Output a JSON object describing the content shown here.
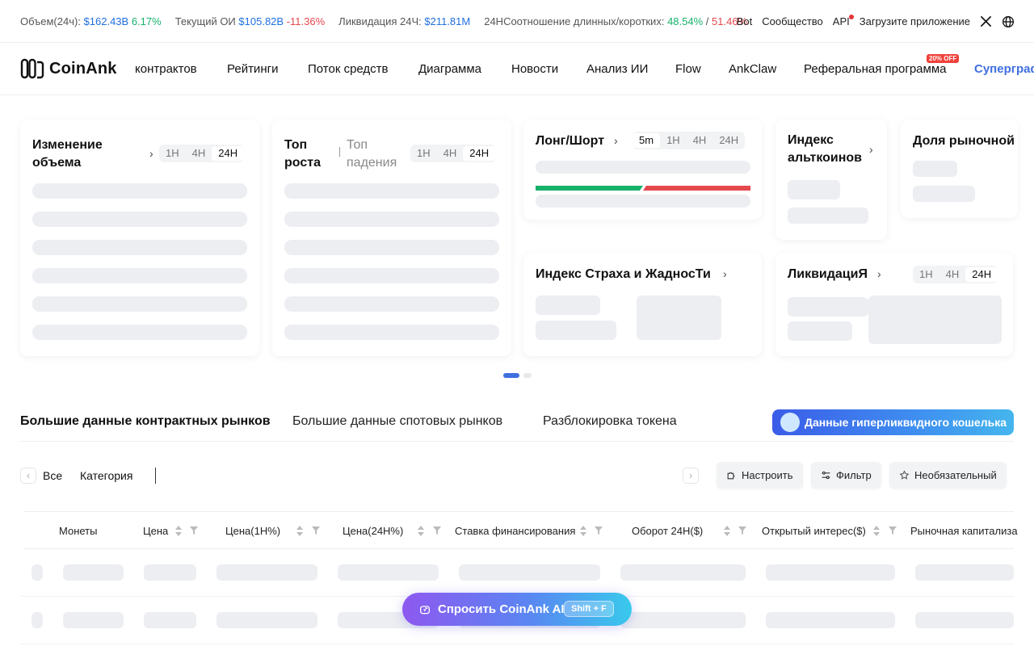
{
  "ticker": {
    "volume_label": "Объем(24ч):",
    "volume_value": "$162.43B",
    "volume_change": "6.17%",
    "oi_label": "Текущий ОИ",
    "oi_value": "$105.82B",
    "oi_change": "-11.36%",
    "liq_label": "Ликвидация 24Ч:",
    "liq_value": "$211.81M",
    "ratio_label": "24НСоотношение длинных/коротких:",
    "ratio_long": "48.54%",
    "ratio_sep": "/",
    "ratio_short": "51.46%",
    "links": [
      "Bot",
      "Сообщество",
      "API",
      "Загрузите приложение"
    ]
  },
  "nav": {
    "logo": "CoinAnk",
    "items": [
      "контрактов",
      "Рейтинги",
      "Поток средств",
      "Диаграмма",
      "Новости",
      "Анализ ИИ",
      "Flow",
      "AnkClaw",
      "Реферальная программа",
      "Суперграф"
    ],
    "badge": "20% OFF"
  },
  "cards": {
    "volume_change": {
      "title": "Изменение объема",
      "periods": [
        "1H",
        "4H",
        "24H"
      ],
      "active": "24H"
    },
    "top": {
      "tab_rise": "Топ роста",
      "tab_fall": "Топ падения",
      "periods": [
        "1H",
        "4H",
        "24H"
      ],
      "active": "24H"
    },
    "long_short": {
      "title": "Лонг/Шорт",
      "periods": [
        "5m",
        "1H",
        "4H",
        "24H"
      ],
      "active": "5m",
      "long_ratio": 0.5
    },
    "altcoin": {
      "title": "Индекс альткоинов"
    },
    "market_share": {
      "title": "Доля рыночной"
    },
    "fear_greed": {
      "title": "Индекс Страха и ЖадносТи"
    },
    "liquidation": {
      "title": "ЛиквидациЯ",
      "periods": [
        "1H",
        "4H",
        "24H"
      ],
      "active": "24H"
    }
  },
  "carousel": {
    "pages": 2,
    "active": 1
  },
  "tabs": [
    "Большие данные контрактных рынков",
    "Большие данные спотовых рынков",
    "Разблокировка токена"
  ],
  "hyper_button": "Данные гиперликвидного кошелька",
  "filters": {
    "all": "Все",
    "category": "Категория",
    "customize": "Настроить",
    "filter": "Фильтр",
    "optional": "Необязательный"
  },
  "table": {
    "columns": [
      "Монеты",
      "Цена",
      "Цена(1Н%)",
      "Цена(24Н%)",
      "Ставка финансирования",
      "Оборот 24Н($)",
      "Открытый интерес($)",
      "Рыночная капитализа"
    ]
  },
  "ai": {
    "label": "Спросить CoinAnk AI",
    "shortcut": "Shift + F"
  },
  "colors": {
    "accent": "#3f6fe0",
    "long": "#17b26a",
    "short": "#e5484d",
    "skeleton": "#eceef1"
  }
}
